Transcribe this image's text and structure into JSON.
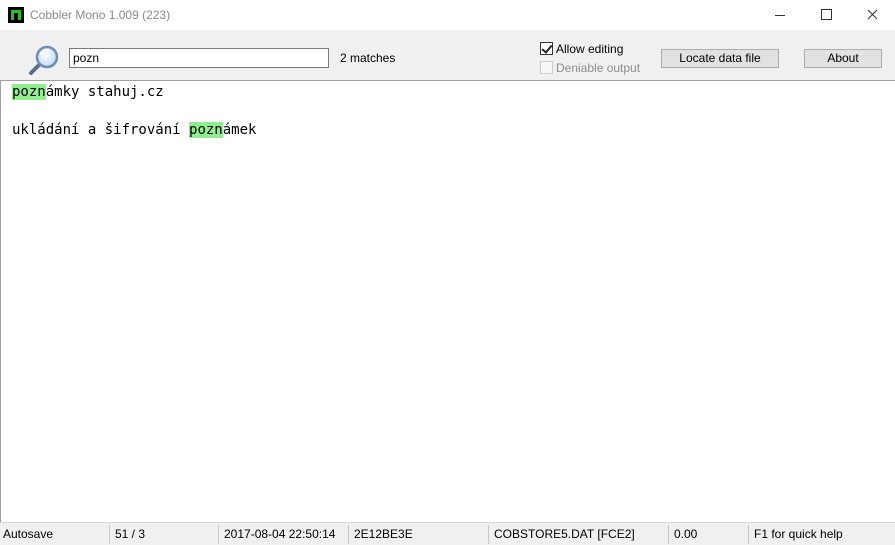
{
  "window": {
    "title": "Cobbler Mono 1.009 (223)"
  },
  "toolbar": {
    "search_value": "pozn",
    "match_count": "2 matches",
    "allow_editing_label": "Allow editing",
    "allow_editing_checked": true,
    "deniable_output_label": "Deniable output",
    "deniable_output_checked": false,
    "locate_button": "Locate data file",
    "about_button": "About"
  },
  "editor": {
    "lines": [
      {
        "match": "pozn",
        "after": "ámky stahuj.cz"
      },
      {
        "before": "ukládání a šifrování ",
        "match": "pozn",
        "after": "ámek"
      }
    ]
  },
  "status": {
    "autosave": "Autosave",
    "position": "51 / 3",
    "timestamp": "2017-08-04 22:50:14",
    "hash": "2E12BE3E",
    "file": "COBSTORE5.DAT [FCE2]",
    "value": "0.00",
    "help": "F1 for quick help"
  },
  "colors": {
    "highlight": "#90ee90",
    "app_icon_accent": "#1ec41e"
  },
  "icons": [
    "app-icon",
    "search-icon",
    "minimize-icon",
    "maximize-icon",
    "close-icon"
  ]
}
